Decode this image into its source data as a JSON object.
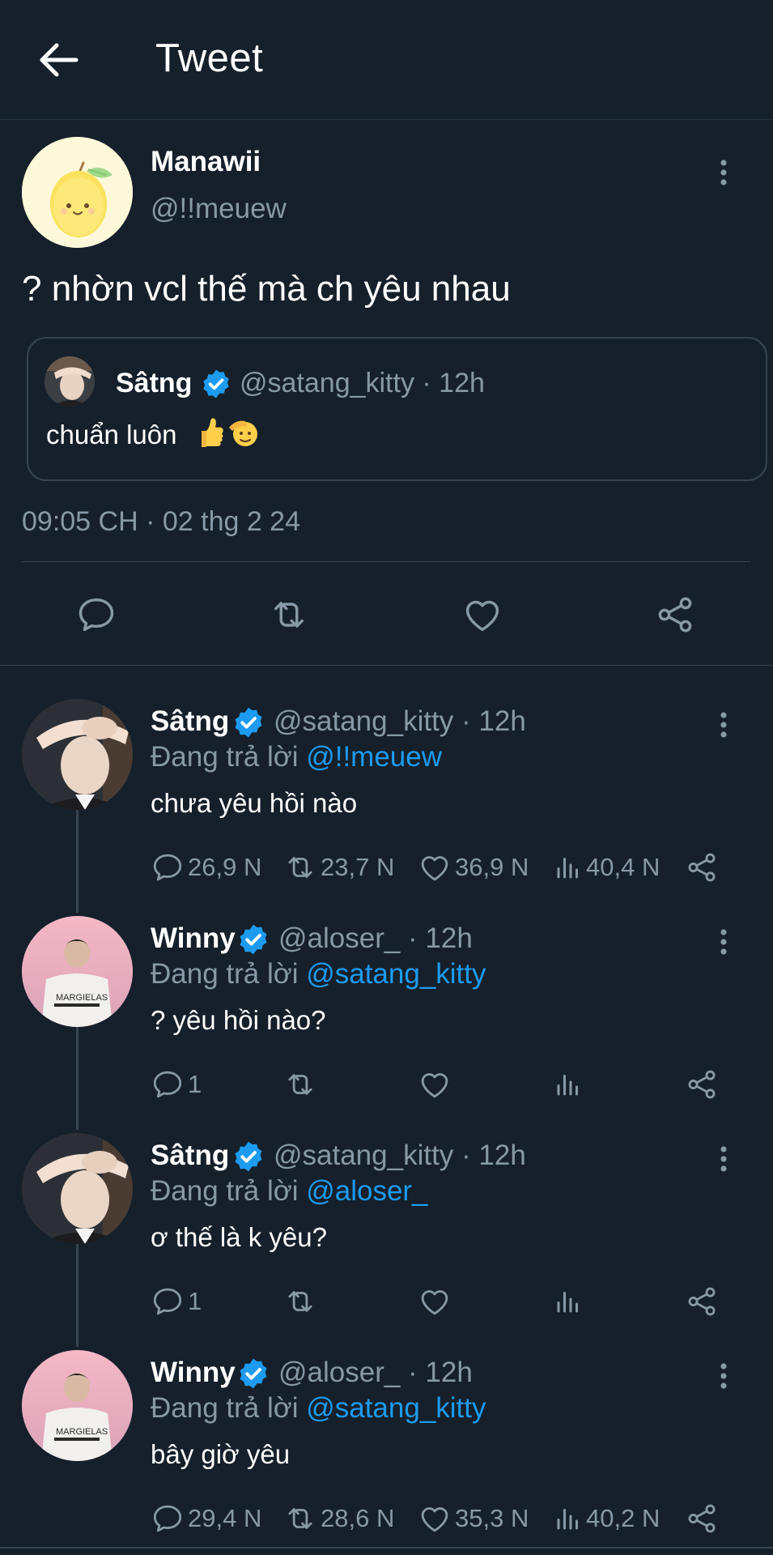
{
  "header": {
    "title": "Tweet",
    "back_icon": "arrow-left-icon"
  },
  "main_tweet": {
    "display_name": "Manawii",
    "handle": "@!!meuew",
    "text": "? nhờn vcl thế mà ch yêu nhau",
    "timestamp": "09:05 CH · 02 thg 2 24",
    "quote": {
      "display_name": "Sâtng",
      "handle_time": "@satang_kitty · 12h",
      "text": "chuẩn luôn",
      "emojis": [
        "thumbs-up",
        "saluting-face"
      ]
    }
  },
  "replies": [
    {
      "display_name": "Sâtng",
      "handle_time": "@satang_kitty · 12h",
      "replying_prefix": "Đang trả lời",
      "replying_to": "@!!meuew",
      "text": "chưa yêu hồi nào",
      "reply_count": "26,9 N",
      "retweet_count": "23,7 N",
      "like_count": "36,9 N",
      "view_count": "40,4 N"
    },
    {
      "display_name": "Winny",
      "handle_time": "@aloser_ · 12h",
      "replying_prefix": "Đang trả lời",
      "replying_to": "@satang_kitty",
      "text": "? yêu hồi nào?",
      "reply_count": "1",
      "retweet_count": "",
      "like_count": "",
      "view_count": ""
    },
    {
      "display_name": "Sâtng",
      "handle_time": "@satang_kitty · 12h",
      "replying_prefix": "Đang trả lời",
      "replying_to": "@aloser_",
      "text": "ơ thế là k yêu?",
      "reply_count": "1",
      "retweet_count": "",
      "like_count": "",
      "view_count": ""
    },
    {
      "display_name": "Winny",
      "handle_time": "@aloser_ · 12h",
      "replying_prefix": "Đang trả lời",
      "replying_to": "@satang_kitty",
      "text": "bây giờ yêu",
      "reply_count": "29,4 N",
      "retweet_count": "28,6 N",
      "like_count": "35,3 N",
      "view_count": "40,2 N"
    }
  ],
  "colors": {
    "background": "#15202b",
    "text": "#ffffff",
    "muted": "#8899a6",
    "link": "#1d9bf0",
    "border": "#38444d",
    "verified": "#1d9bf0"
  }
}
